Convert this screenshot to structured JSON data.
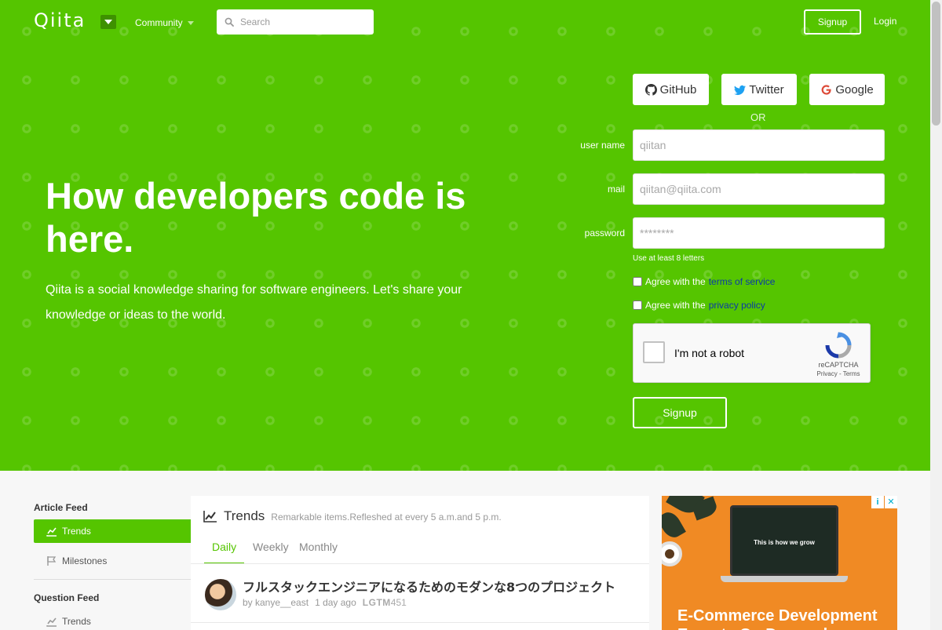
{
  "header": {
    "logo": "Qiita",
    "community": "Community",
    "search_placeholder": "Search",
    "signup": "Signup",
    "login": "Login"
  },
  "hero": {
    "title": "How developers code is here.",
    "description": "Qiita is a social knowledge sharing for software engineers. Let's share your knowledge or ideas to the world."
  },
  "signup_form": {
    "github": "GitHub",
    "twitter": "Twitter",
    "google": "Google",
    "or": "OR",
    "username_label": "user name",
    "username_placeholder": "qiitan",
    "mail_label": "mail",
    "mail_placeholder": "qiitan@qiita.com",
    "password_label": "password",
    "password_placeholder": "********",
    "password_hint": "Use at least 8 letters",
    "agree_prefix": "Agree with the",
    "terms_link": "terms of service",
    "privacy_link": "privacy policy",
    "recaptcha_label": "I'm not a robot",
    "recaptcha_brand": "reCAPTCHA",
    "recaptcha_links": "Privacy - Terms",
    "submit": "Signup"
  },
  "sidebar": {
    "article_feed_heading": "Article Feed",
    "article_items": [
      {
        "label": "Trends",
        "active": true
      },
      {
        "label": "Milestones",
        "active": false
      }
    ],
    "question_feed_heading": "Question Feed",
    "question_items": [
      {
        "label": "Trends",
        "active": false
      }
    ]
  },
  "feed": {
    "title": "Trends",
    "subtitle": "Remarkable items.Refleshed at every 5 a.m.and 5 p.m.",
    "tabs": [
      {
        "label": "Daily",
        "active": true
      },
      {
        "label": "Weekly",
        "active": false
      },
      {
        "label": "Monthly",
        "active": false
      }
    ],
    "articles": [
      {
        "title": "フルスタックエンジニアになるためのモダンな8つのプロジェクト",
        "author": "by kanye__east",
        "time": "1 day ago",
        "lgtm_label": "LGTM",
        "lgtm_count": "451"
      }
    ]
  },
  "ad": {
    "screen_text": "This is how we grow",
    "headline": "E-Commerce Development Experts On Demand"
  },
  "colors": {
    "brand": "#55c500",
    "link": "#0b3aa8"
  }
}
